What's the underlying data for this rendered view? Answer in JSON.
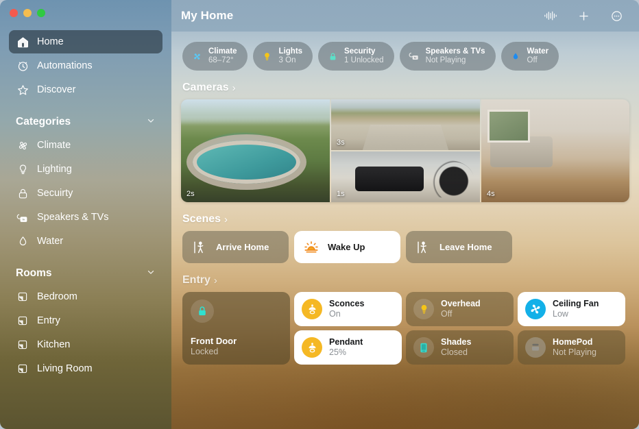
{
  "window": {
    "traffic_lights": [
      "close",
      "minimize",
      "zoom"
    ],
    "title": "My Home"
  },
  "toolbar": {
    "siri_label": "waveform-icon",
    "add_label": "plus-icon",
    "more_label": "more-icon"
  },
  "sidebar": {
    "nav": [
      {
        "label": "Home",
        "icon": "house-icon",
        "selected": true
      },
      {
        "label": "Automations",
        "icon": "clock-icon",
        "selected": false
      },
      {
        "label": "Discover",
        "icon": "star-icon",
        "selected": false
      }
    ],
    "categories": {
      "header": "Categories",
      "items": [
        {
          "label": "Climate",
          "icon": "fan-icon"
        },
        {
          "label": "Lighting",
          "icon": "bulb-icon"
        },
        {
          "label": "Secuirty",
          "icon": "lock-icon"
        },
        {
          "label": "Speakers & TVs",
          "icon": "speaker-tv-icon"
        },
        {
          "label": "Water",
          "icon": "droplet-icon"
        }
      ]
    },
    "rooms": {
      "header": "Rooms",
      "items": [
        {
          "label": "Bedroom",
          "icon": "room-icon"
        },
        {
          "label": "Entry",
          "icon": "room-icon"
        },
        {
          "label": "Kitchen",
          "icon": "room-icon"
        },
        {
          "label": "Living Room",
          "icon": "room-icon"
        }
      ]
    }
  },
  "status_pills": [
    {
      "name": "Climate",
      "value": "68–72°",
      "icon": "fan-icon",
      "color": "#5ac8f5"
    },
    {
      "name": "Lights",
      "value": "3 On",
      "icon": "bulb-icon",
      "color": "#f5c518"
    },
    {
      "name": "Security",
      "value": "1 Unlocked",
      "icon": "lock-icon",
      "color": "#5ce0c8"
    },
    {
      "name": "Speakers & TVs",
      "value": "Not Playing",
      "icon": "speaker-tv-icon",
      "color": "#e8e8e8"
    },
    {
      "name": "Water",
      "value": "Off",
      "icon": "droplet-icon",
      "color": "#1e8cf0"
    }
  ],
  "sections": {
    "cameras": {
      "title": "Cameras",
      "chevron": "›"
    },
    "scenes": {
      "title": "Scenes",
      "chevron": "›"
    },
    "entry": {
      "title": "Entry",
      "chevron": "›"
    }
  },
  "cameras": [
    {
      "name": "pool-camera",
      "badge": "2s"
    },
    {
      "name": "driveway-camera",
      "badge": "3s"
    },
    {
      "name": "garage-camera",
      "badge": "1s"
    },
    {
      "name": "living-room-camera",
      "badge": "4s"
    }
  ],
  "scenes": [
    {
      "label": "Arrive Home",
      "icon": "person-arrive-icon",
      "active": false
    },
    {
      "label": "Wake Up",
      "icon": "sunrise-icon",
      "active": true
    },
    {
      "label": "Leave Home",
      "icon": "person-leave-icon",
      "active": false
    }
  ],
  "accessories": [
    {
      "label": "Front Door",
      "state": "Locked",
      "icon": "lock-icon",
      "style": "tall",
      "icon_color": "#2fe0d0"
    },
    {
      "label": "Sconces",
      "state": "On",
      "icon": "sconce-icon",
      "style": "on",
      "icon_color": "#f5b824"
    },
    {
      "label": "Overhead",
      "state": "Off",
      "icon": "bulb-icon",
      "style": "off",
      "icon_color": "#f5c518"
    },
    {
      "label": "Ceiling Fan",
      "state": "Low",
      "icon": "fan-icon",
      "style": "on",
      "icon_color": "#13b0e8"
    },
    {
      "label": "Pendant",
      "state": "25%",
      "icon": "sconce-icon",
      "style": "on",
      "icon_color": "#f5b824"
    },
    {
      "label": "Shades",
      "state": "Closed",
      "icon": "shade-icon",
      "style": "off",
      "icon_color": "#3ad6c8"
    },
    {
      "label": "HomePod",
      "state": "Not Playing",
      "icon": "homepod-icon",
      "style": "off",
      "icon_color": "#b9b4aa"
    }
  ]
}
